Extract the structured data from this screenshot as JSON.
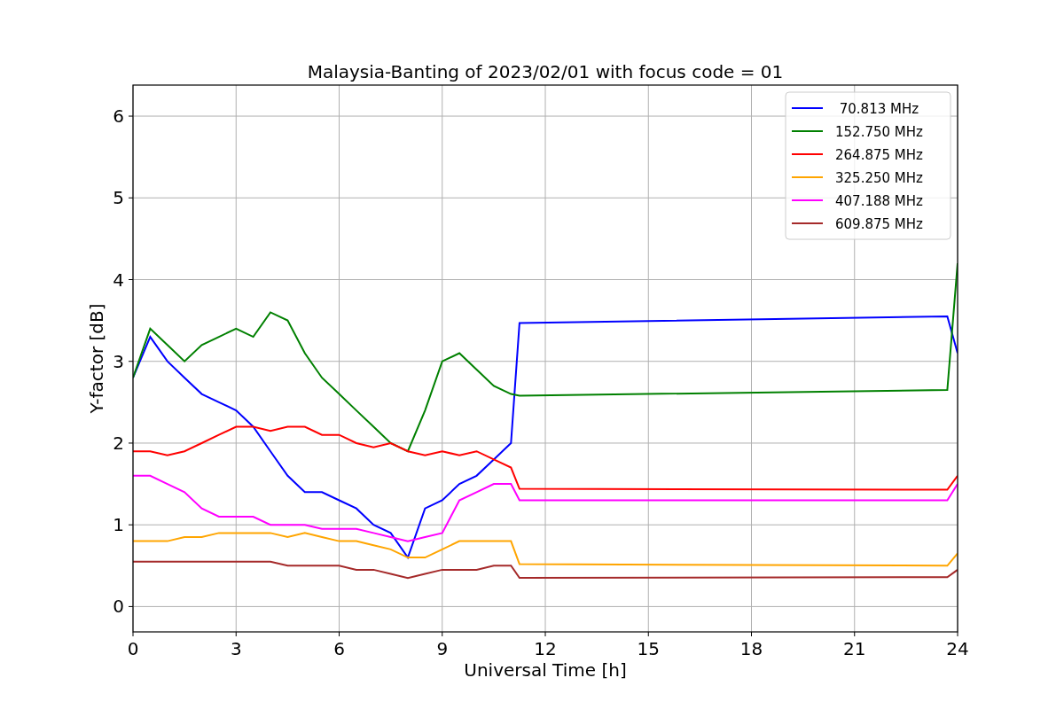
{
  "figure": {
    "chart_data": {
      "type": "line",
      "title": "Malaysia-Banting of 2023/02/01 with focus code = 01",
      "xlabel": "Universal Time [h]",
      "ylabel": "Y-factor [dB]",
      "x": [
        0,
        0.5,
        1,
        1.5,
        2,
        2.5,
        3,
        3.5,
        4,
        4.5,
        5,
        5.5,
        6,
        6.5,
        7,
        7.5,
        8,
        8.5,
        9,
        9.5,
        10,
        10.5,
        11,
        11.25,
        23.7,
        24
      ],
      "series": [
        {
          "name": " 70.813 MHz",
          "color": "#0000ff",
          "values": [
            2.8,
            3.3,
            3.0,
            2.8,
            2.6,
            2.5,
            2.4,
            2.2,
            1.9,
            1.6,
            1.4,
            1.4,
            1.3,
            1.2,
            1.0,
            0.9,
            0.6,
            1.2,
            1.3,
            1.5,
            1.6,
            1.8,
            2.0,
            3.47,
            3.55,
            3.1
          ]
        },
        {
          "name": "152.750 MHz",
          "color": "#008000",
          "values": [
            2.8,
            3.4,
            3.2,
            3.0,
            3.2,
            3.3,
            3.4,
            3.3,
            3.6,
            3.5,
            3.1,
            2.8,
            2.6,
            2.4,
            2.2,
            2.0,
            1.9,
            2.4,
            3.0,
            3.1,
            2.9,
            2.7,
            2.6,
            2.58,
            2.65,
            4.2
          ]
        },
        {
          "name": "264.875 MHz",
          "color": "#ff0000",
          "values": [
            1.9,
            1.9,
            1.85,
            1.9,
            2.0,
            2.1,
            2.2,
            2.2,
            2.15,
            2.2,
            2.2,
            2.1,
            2.1,
            2.0,
            1.95,
            2.0,
            1.9,
            1.85,
            1.9,
            1.85,
            1.9,
            1.8,
            1.7,
            1.44,
            1.43,
            1.6
          ]
        },
        {
          "name": "325.250 MHz",
          "color": "#ffa500",
          "values": [
            0.8,
            0.8,
            0.8,
            0.85,
            0.85,
            0.9,
            0.9,
            0.9,
            0.9,
            0.85,
            0.9,
            0.85,
            0.8,
            0.8,
            0.75,
            0.7,
            0.6,
            0.6,
            0.7,
            0.8,
            0.8,
            0.8,
            0.8,
            0.52,
            0.5,
            0.65
          ]
        },
        {
          "name": "407.188 MHz",
          "color": "#ff00ff",
          "values": [
            1.6,
            1.6,
            1.5,
            1.4,
            1.2,
            1.1,
            1.1,
            1.1,
            1.0,
            1.0,
            1.0,
            0.95,
            0.95,
            0.95,
            0.9,
            0.85,
            0.8,
            0.85,
            0.9,
            1.3,
            1.4,
            1.5,
            1.5,
            1.3,
            1.3,
            1.5
          ]
        },
        {
          "name": "609.875 MHz",
          "color": "#a52a2a",
          "values": [
            0.55,
            0.55,
            0.55,
            0.55,
            0.55,
            0.55,
            0.55,
            0.55,
            0.55,
            0.5,
            0.5,
            0.5,
            0.5,
            0.45,
            0.45,
            0.4,
            0.35,
            0.4,
            0.45,
            0.45,
            0.45,
            0.5,
            0.5,
            0.35,
            0.36,
            0.45
          ]
        }
      ],
      "xlim": [
        0,
        24
      ],
      "ylim": [
        -0.31,
        6.38
      ],
      "xticks": [
        0,
        3,
        6,
        9,
        12,
        15,
        18,
        21,
        24
      ],
      "yticks": [
        0,
        1,
        2,
        3,
        4,
        5,
        6
      ],
      "grid": true,
      "legend": true
    }
  }
}
